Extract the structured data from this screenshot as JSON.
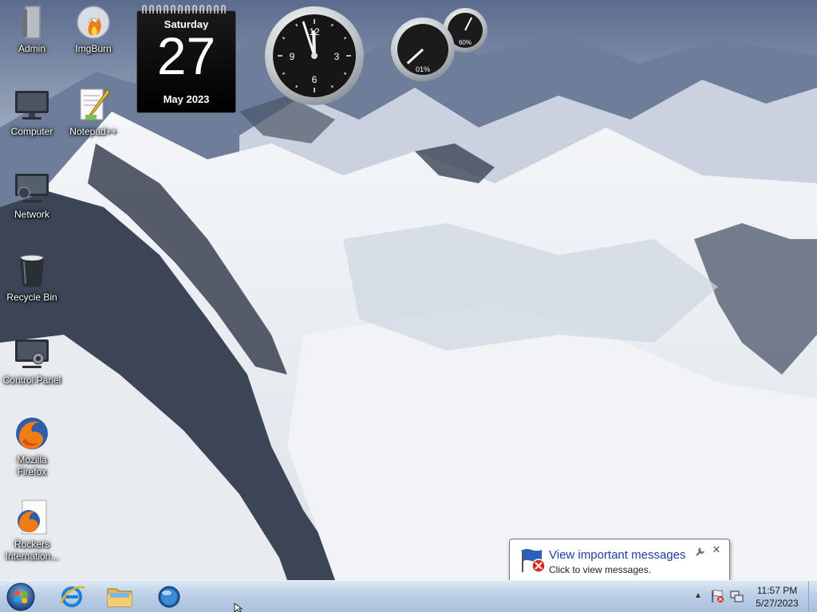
{
  "desktop": {
    "icons": [
      {
        "label": "Admin",
        "icon": "user-folder-icon"
      },
      {
        "label": "ImgBurn",
        "icon": "imgburn-icon"
      },
      {
        "label": "Computer",
        "icon": "computer-icon"
      },
      {
        "label": "Notepad++",
        "icon": "notepadpp-icon"
      },
      {
        "label": "Network",
        "icon": "network-icon"
      },
      {
        "label": "Recycle Bin",
        "icon": "recycle-bin-icon"
      },
      {
        "label": "Control Panel",
        "icon": "control-panel-icon"
      },
      {
        "label": "Mozilla Firefox",
        "icon": "firefox-icon"
      },
      {
        "label": "Rockers Internation...",
        "icon": "firefox-shortcut-icon"
      }
    ]
  },
  "gadgets": {
    "calendar": {
      "day_name": "Saturday",
      "day_number": "27",
      "month_year": "May 2023"
    },
    "clock": {
      "hour": 11,
      "minute": 57,
      "numerals": [
        "12",
        "3",
        "6",
        "9"
      ]
    },
    "cpu_meter": {
      "cpu_percent_label": "01%",
      "memory_percent_label": "60%",
      "cpu_percent": 1,
      "memory_percent": 60
    }
  },
  "notification": {
    "title": "View important messages",
    "body": "Click to view messages.",
    "icon": "action-center-flag-icon"
  },
  "taskbar": {
    "pinned": [
      {
        "name": "internet-explorer",
        "icon": "internet-explorer-icon"
      },
      {
        "name": "windows-explorer",
        "icon": "folder-icon"
      },
      {
        "name": "windows-media-player",
        "icon": "media-player-icon"
      }
    ],
    "tray": {
      "time": "11:57 PM",
      "date": "5/27/2023"
    }
  },
  "colors": {
    "taskbar_top": "#dce8f5",
    "taskbar_bottom": "#a9c0dd",
    "balloon_title": "#1c3fa5"
  }
}
